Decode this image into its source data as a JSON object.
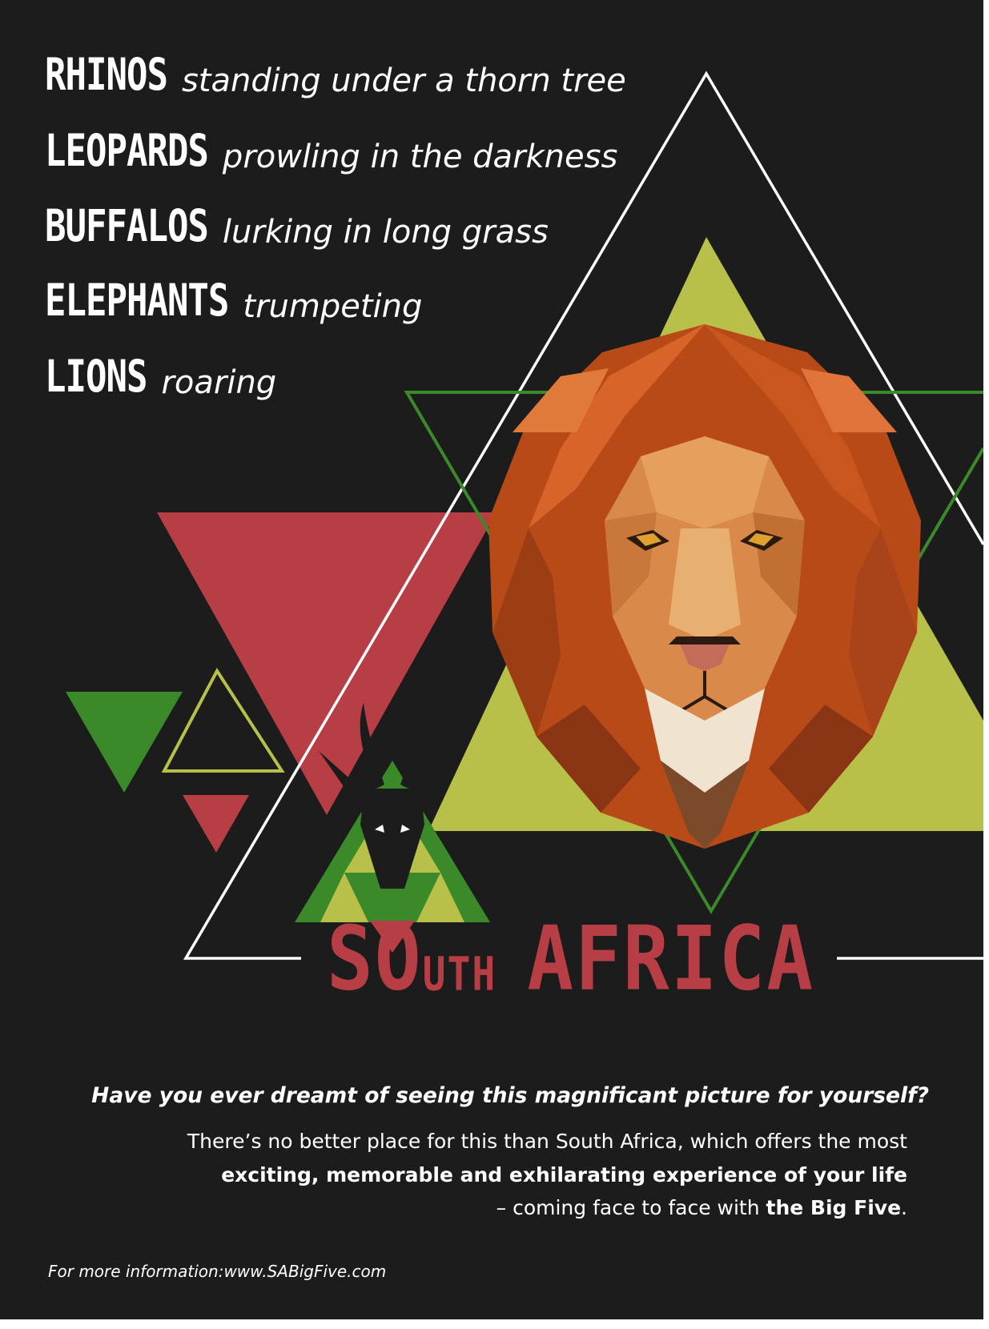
{
  "animals": [
    {
      "name": "RHINOS",
      "description": "standing under a thorn tree"
    },
    {
      "name": "LEOPARDS",
      "description": "prowling in the darkness"
    },
    {
      "name": "BUFFALOS",
      "description": "lurking in long grass"
    },
    {
      "name": "ELEPHANTS",
      "description": "trumpeting"
    },
    {
      "name": "LIONS",
      "description": "roaring"
    }
  ],
  "title": {
    "part1": "SO",
    "part2": "UTH",
    "part3": "AFRICA"
  },
  "question": "Have you ever dreamt of seeing this magnificant picture for yourself?",
  "body": {
    "line1": "There’s no better place for this than South Africa, which offers the most",
    "line2_bold": "exciting, memorable and exhilarating experience of your life",
    "line3_prefix": "– coming face to face with ",
    "line3_bold": "the Big Five",
    "line3_suffix": "."
  },
  "footer": "For more information:www.SABigFive.com",
  "colors": {
    "background": "#1c1c1c",
    "red": "#b83e45",
    "green": "#3a8a2a",
    "lime": "#b9c04a",
    "white": "#ffffff"
  },
  "icons": [
    "lion-head-illustration",
    "antelope-head-icon"
  ]
}
